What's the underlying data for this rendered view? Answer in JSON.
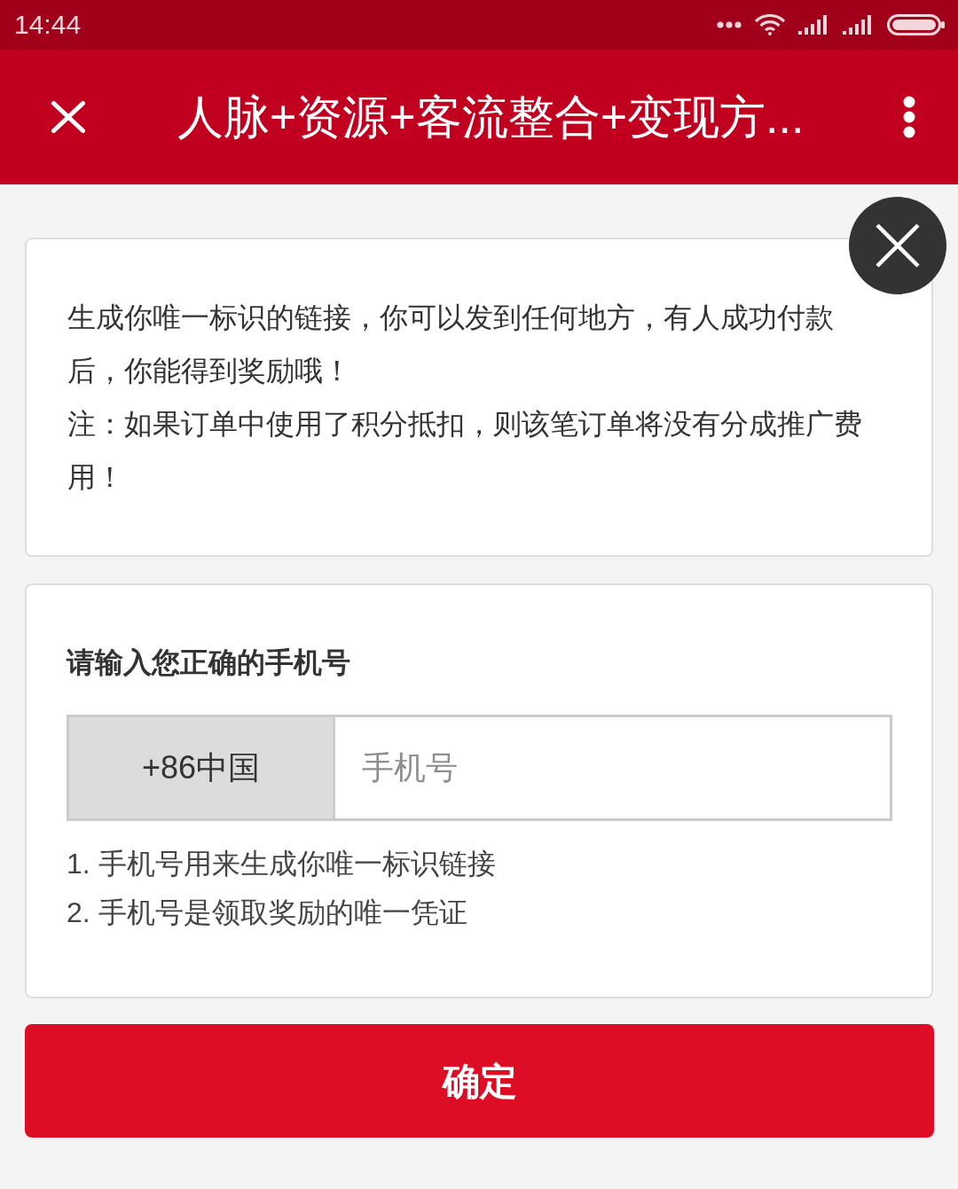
{
  "status_bar": {
    "time": "14:44"
  },
  "header": {
    "title": "人脉+资源+客流整合+变现方..."
  },
  "notice": {
    "paragraphs": [
      "生成你唯一标识的链接，你可以发到任何地方，有人成功付款后，你能得到奖励哦！",
      "注：如果订单中使用了积分抵扣，则该笔订单将没有分成推广费用！"
    ]
  },
  "phone_form": {
    "label": "请输入您正确的手机号",
    "country_code": "+86中国",
    "phone_field": {
      "placeholder": "手机号"
    },
    "notes": [
      "1. 手机号用来生成你唯一标识链接",
      "2. 手机号是领取奖励的唯一凭证"
    ]
  },
  "confirm_button": {
    "label": "确定"
  }
}
